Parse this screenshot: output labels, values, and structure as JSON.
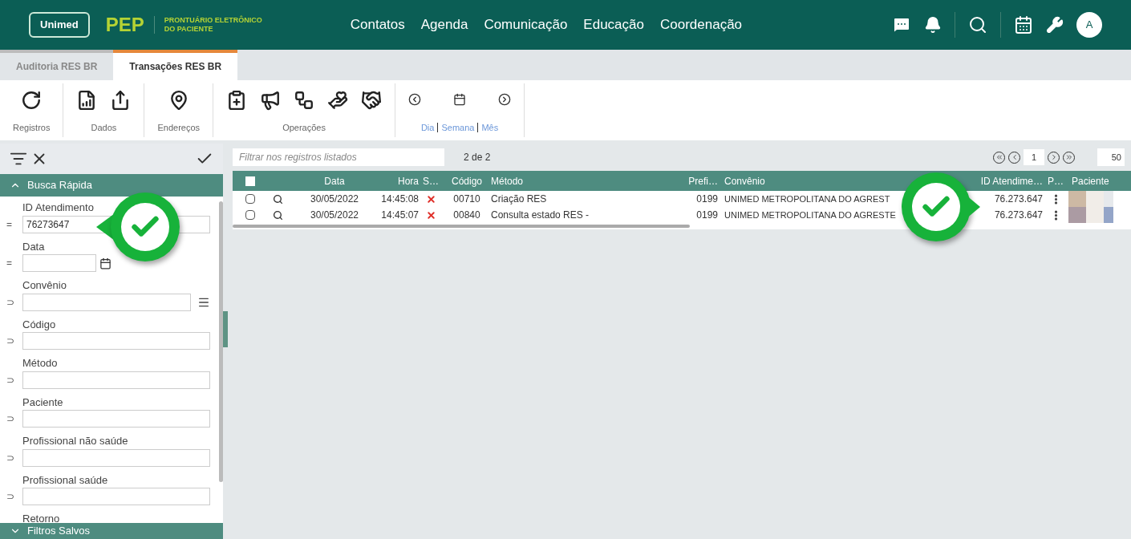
{
  "header": {
    "logo": "Unimed",
    "app": "PEP",
    "subtitle_lines": [
      "PRONTUÁRIO ELETRÔNICO",
      "DO PACIENTE"
    ],
    "nav": [
      "Contatos",
      "Agenda",
      "Comunicação",
      "Educação",
      "Coordenação"
    ],
    "avatar": "A"
  },
  "tabs": [
    {
      "label": "Auditoria RES BR",
      "selected": false
    },
    {
      "label": "Transações RES BR",
      "selected": true
    }
  ],
  "toolbar": {
    "groups": [
      {
        "label": "Registros"
      },
      {
        "label": "Dados"
      },
      {
        "label": "Endereços"
      },
      {
        "label": "Operações"
      }
    ],
    "date_nav": {
      "links": [
        {
          "label": "Dia",
          "selected": false
        },
        {
          "label": "Semana",
          "selected": false
        },
        {
          "label": "Mês",
          "selected": false
        }
      ]
    }
  },
  "filter_panel": {
    "section": "Busca Rápida",
    "expanded": true,
    "fields": [
      {
        "label": "ID Atendimento",
        "operator": "=",
        "value": "76273647",
        "kind": "text"
      },
      {
        "label": "Data",
        "operator": "=",
        "kind": "date"
      },
      {
        "label": "Convênio",
        "operator": "⊃",
        "kind": "list"
      },
      {
        "label": "Código",
        "operator": "⊃",
        "kind": "text"
      },
      {
        "label": "Método",
        "operator": "⊃",
        "kind": "text"
      },
      {
        "label": "Paciente",
        "operator": "⊃",
        "kind": "text"
      },
      {
        "label": "Profissional não saúde",
        "operator": "⊃",
        "kind": "text"
      },
      {
        "label": "Profissional saúde",
        "operator": "⊃",
        "kind": "text"
      },
      {
        "label": "Retorno",
        "kind": "cut"
      }
    ],
    "saved_section": "Filtros Salvos"
  },
  "grid": {
    "filter_placeholder": "Filtrar nos registros listados",
    "count": "2 de 2",
    "page": "1",
    "page_size": "50",
    "columns": [
      "Data",
      "Hora",
      "S…",
      "Código",
      "Método",
      "Prefi…",
      "Convênio",
      "ID Atendime…",
      "P…",
      "Paciente"
    ],
    "all_checked": false,
    "rows": [
      {
        "checked": false,
        "date": "30/05/2022",
        "time": "14:45:08",
        "failed": true,
        "code": "00710",
        "method": "Criação RES",
        "prefix": "0199",
        "plan": "UNIMED METROPOLITANA DO AGREST",
        "id": "76.273.647"
      },
      {
        "checked": false,
        "date": "30/05/2022",
        "time": "14:45:07",
        "failed": true,
        "code": "00840",
        "method": "Consulta estado RES -",
        "prefix": "0199",
        "plan": "UNIMED METROPOLITANA DO AGRESTE",
        "id": "76.273.647"
      }
    ]
  }
}
